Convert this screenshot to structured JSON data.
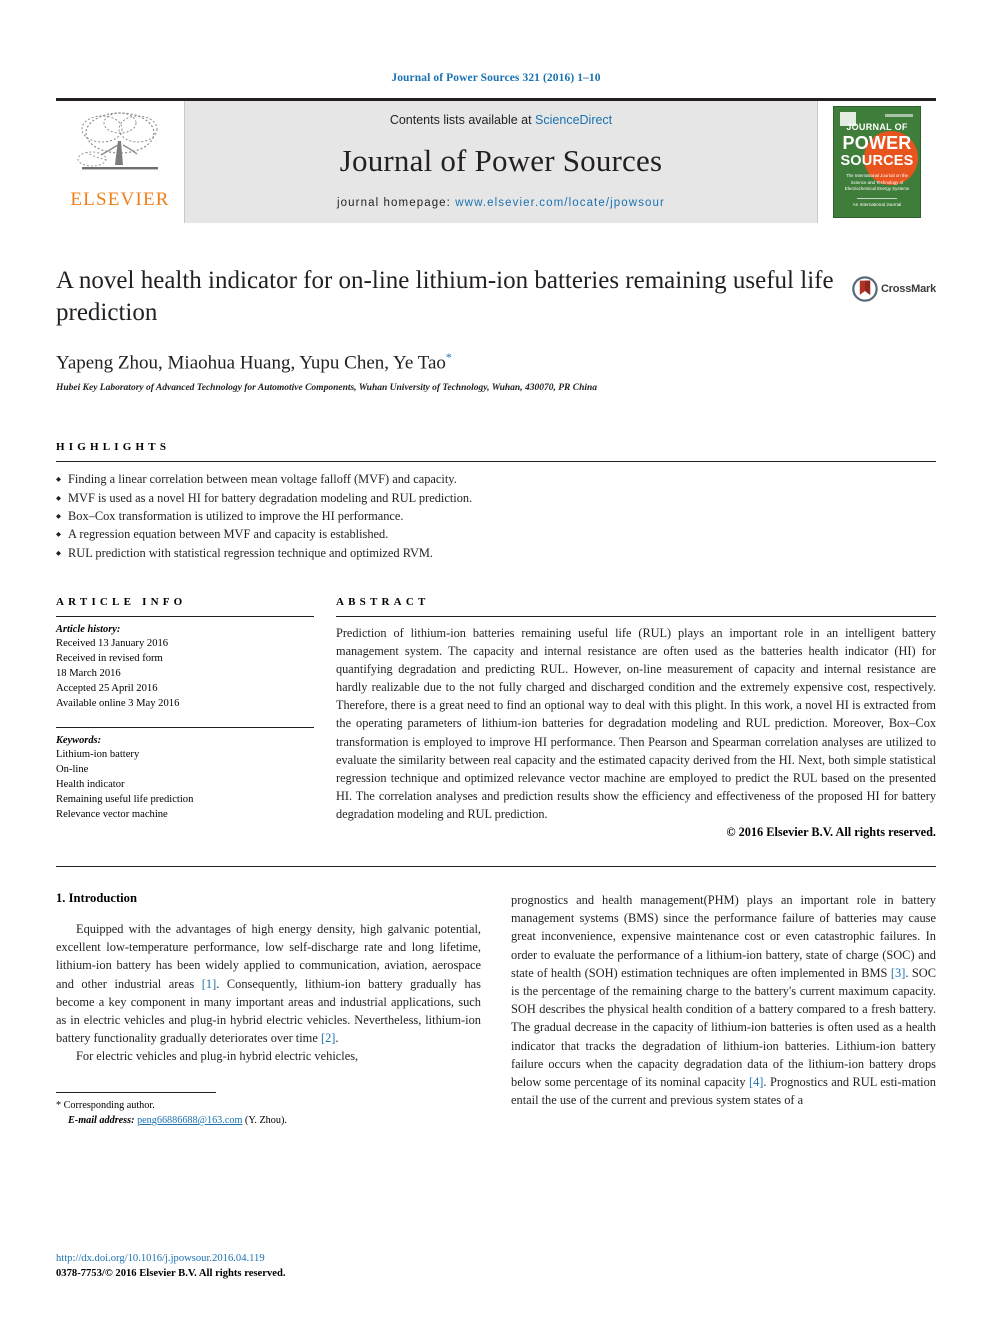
{
  "running_head": "Journal of Power Sources 321 (2016) 1–10",
  "masthead": {
    "contents_prefix": "Contents lists available at ",
    "contents_link": "ScienceDirect",
    "journal_name": "Journal of Power Sources",
    "homepage_prefix": "journal homepage: ",
    "homepage_link": "www.elsevier.com/locate/jpowsour",
    "publisher": "ELSEVIER",
    "cover": {
      "line1": "JOURNAL OF",
      "line2": "POWER",
      "line3": "SOURCES",
      "subtitle": "The International Journal on the Science and Technology of Electrochemical Energy Systems",
      "footer": "An International Journal"
    }
  },
  "article": {
    "title": "A novel health indicator for on-line lithium-ion batteries remaining useful life prediction",
    "authors": "Yapeng Zhou, Miaohua Huang, Yupu Chen, Ye Tao",
    "author_marker": "*",
    "affiliation": "Hubei Key Laboratory of Advanced Technology for Automotive Components, Wuhan University of Technology, Wuhan, 430070, PR China",
    "crossmark_label": "CrossMark"
  },
  "highlights": {
    "label": "HIGHLIGHTS",
    "items": [
      "Finding a linear correlation between mean voltage falloff (MVF) and capacity.",
      "MVF is used as a novel HI for battery degradation modeling and RUL prediction.",
      "Box–Cox transformation is utilized to improve the HI performance.",
      "A regression equation between MVF and capacity is established.",
      "RUL prediction with statistical regression technique and optimized RVM."
    ]
  },
  "article_info": {
    "label": "ARTICLE INFO",
    "history_heading": "Article history:",
    "history_lines": [
      "Received 13 January 2016",
      "Received in revised form",
      "18 March 2016",
      "Accepted 25 April 2016",
      "Available online 3 May 2016"
    ],
    "keywords_heading": "Keywords:",
    "keywords": [
      "Lithium-ion battery",
      "On-line",
      "Health indicator",
      "Remaining useful life prediction",
      "Relevance vector machine"
    ]
  },
  "abstract": {
    "label": "ABSTRACT",
    "text": "Prediction of lithium-ion batteries remaining useful life (RUL) plays an important role in an intelligent battery management system. The capacity and internal resistance are often used as the batteries health indicator (HI) for quantifying degradation and predicting RUL. However, on-line measurement of capacity and internal resistance are hardly realizable due to the not fully charged and discharged condition and the extremely expensive cost, respectively. Therefore, there is a great need to find an optional way to deal with this plight. In this work, a novel HI is extracted from the operating parameters of lithium-ion batteries for degradation modeling and RUL prediction. Moreover, Box–Cox transformation is employed to improve HI performance. Then Pearson and Spearman correlation analyses are utilized to evaluate the similarity between real capacity and the estimated capacity derived from the HI. Next, both simple statistical regression technique and optimized relevance vector machine are employed to predict the RUL based on the presented HI. The correlation analyses and prediction results show the efficiency and effectiveness of the proposed HI for battery degradation modeling and RUL prediction.",
    "copyright": "© 2016 Elsevier B.V. All rights reserved."
  },
  "body": {
    "section_heading": "1. Introduction",
    "left_para_1_a": "Equipped with the advantages of high energy density, high galvanic potential, excellent low-temperature performance, low self-discharge rate and long lifetime, lithium-ion battery has been widely applied to communication, aviation, aerospace and other industrial areas ",
    "left_cite_1": "[1]",
    "left_para_1_b": ". Consequently, lithium-ion battery gradually has become a key component in many important areas and industrial applications, such as in electric vehicles and plug-in hybrid electric vehicles. Nevertheless, lithium-ion battery functionality gradually deteriorates over time ",
    "left_cite_2": "[2]",
    "left_para_1_c": ".",
    "left_para_2": "For electric vehicles and plug-in hybrid electric vehicles,",
    "right_para_a": "prognostics and health management(PHM) plays an important role in battery management systems (BMS) since the performance failure of batteries may cause great inconvenience, expensive maintenance cost or even catastrophic failures. In order to evaluate the performance of a lithium-ion battery, state of charge (SOC) and state of health (SOH) estimation techniques are often implemented in BMS ",
    "right_cite_3": "[3]",
    "right_para_b": ". SOC is the percentage of the remaining charge to the battery's current maximum capacity. SOH describes the physical health condition of a battery compared to a fresh battery. The gradual decrease in the capacity of lithium-ion batteries is often used as a health indicator that tracks the degradation of lithium-ion batteries. Lithium-ion battery failure occurs when the capacity degradation data of the lithium-ion battery drops below some percentage of its nominal capacity ",
    "right_cite_4": "[4]",
    "right_para_c": ". Prognostics and RUL esti-mation entail the use of the current and previous system states of a"
  },
  "footnote": {
    "corresponding": "* Corresponding author.",
    "email_label": "E-mail address: ",
    "email": "peng66886688@163.com",
    "email_suffix": " (Y. Zhou)."
  },
  "footer": {
    "doi": "http://dx.doi.org/10.1016/j.jpowsour.2016.04.119",
    "issn": "0378-7753/© 2016 Elsevier B.V. All rights reserved."
  }
}
